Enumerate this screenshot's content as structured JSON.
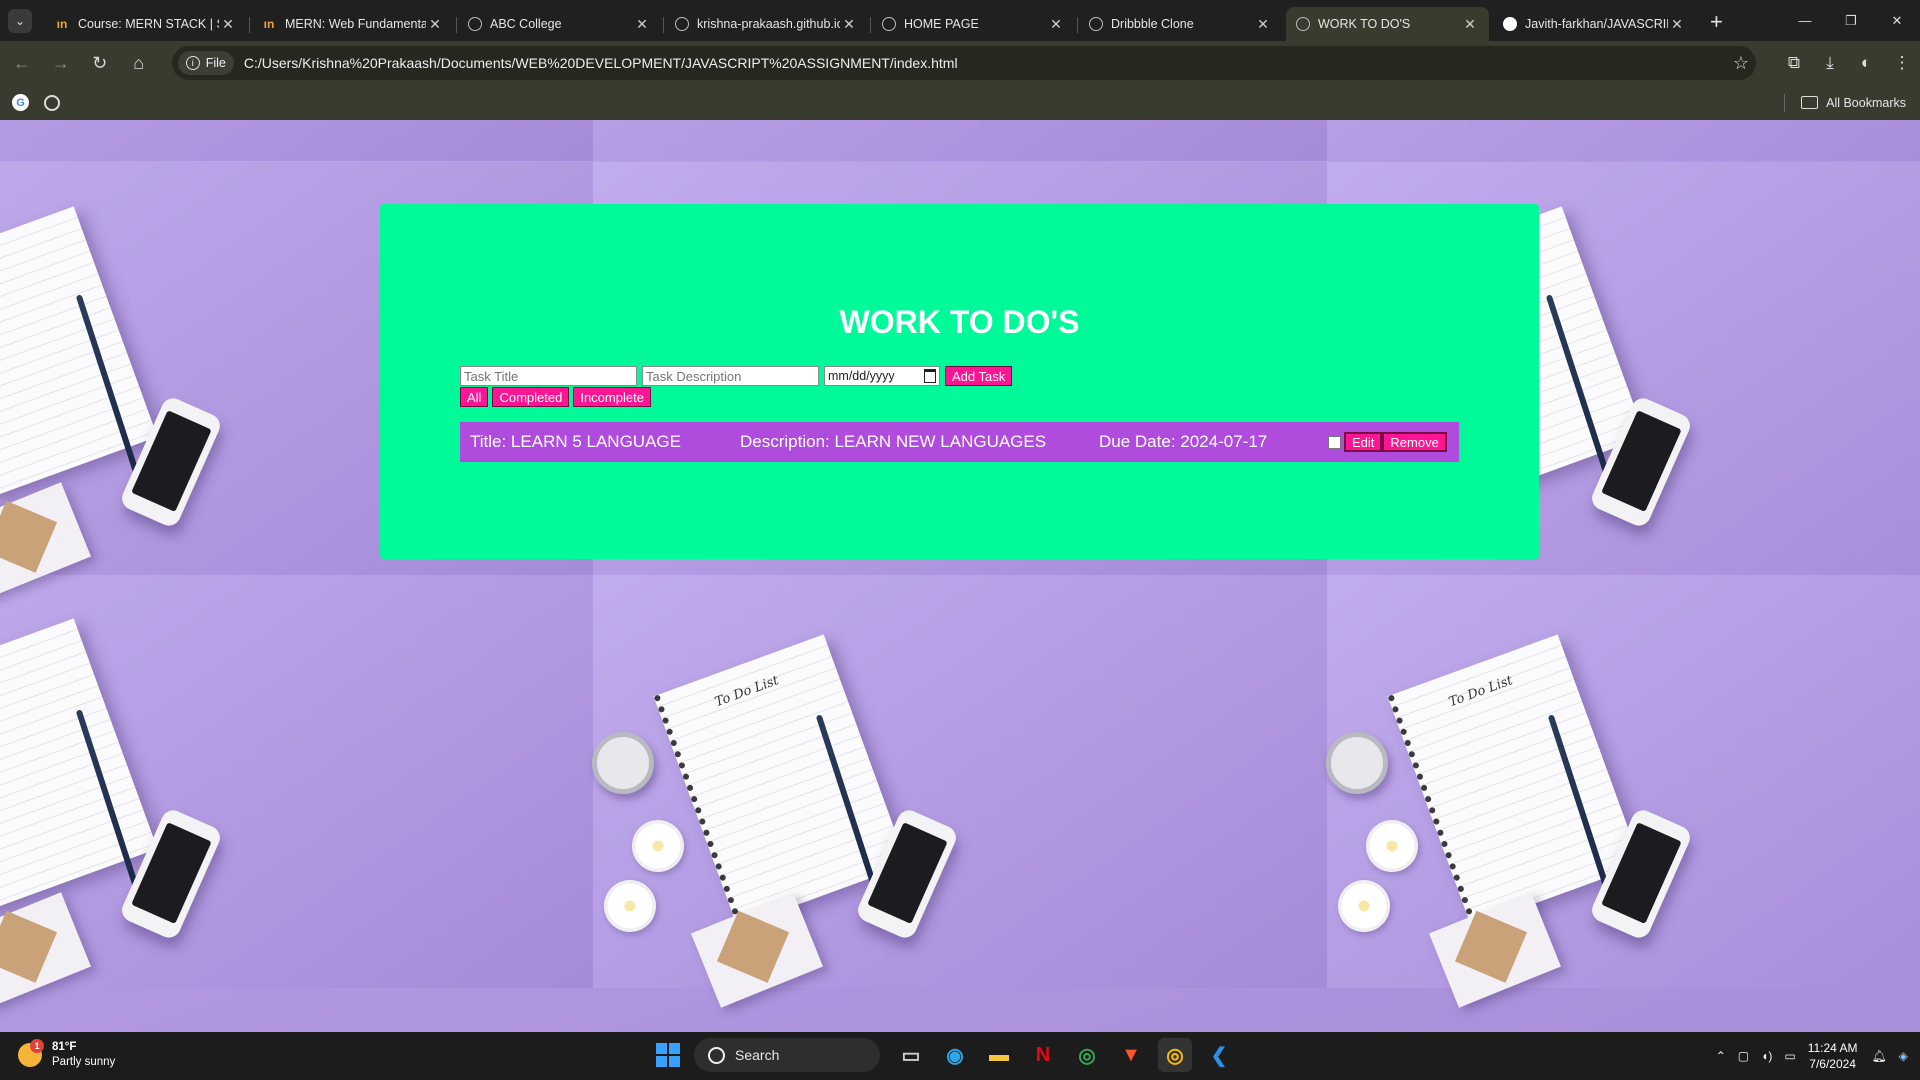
{
  "browser": {
    "tabs": [
      {
        "title": "Course: MERN STACK | SE",
        "favicon": "ftr-icon"
      },
      {
        "title": "MERN: Web Fundamental",
        "favicon": "ftr-icon"
      },
      {
        "title": "ABC College",
        "favicon": "globe-icon"
      },
      {
        "title": "krishna-prakaash.github.io",
        "favicon": "globe-icon"
      },
      {
        "title": "HOME PAGE",
        "favicon": "globe-icon"
      },
      {
        "title": "Dribbble Clone",
        "favicon": "globe-icon"
      },
      {
        "title": "WORK TO DO'S",
        "favicon": "globe-icon",
        "active": true
      },
      {
        "title": "Javith-farkhan/JAVASCRIP",
        "favicon": "github-icon"
      }
    ],
    "scheme_chip": "File",
    "url": "C:/Users/Krishna%20Prakaash/Documents/WEB%20DEVELOPMENT/JAVASCRIPT%20ASSIGNMENT/index.html",
    "bookmarks_label": "All Bookmarks"
  },
  "app": {
    "heading": "WORK TO DO'S",
    "title_placeholder": "Task Title",
    "description_placeholder": "Task Description",
    "date_placeholder": "mm/dd/yyyy",
    "add_task_label": "Add Task",
    "filters": {
      "all": "All",
      "completed": "Completed",
      "incomplete": "Incomplete"
    },
    "tasks": [
      {
        "title": "Title: LEARN 5 LANGUAGE",
        "description": "Description: LEARN NEW LANGUAGES",
        "due": "Due Date: 2024-07-17",
        "completed": false,
        "edit_label": "Edit",
        "remove_label": "Remove"
      }
    ],
    "colors": {
      "card": "#00fa9a",
      "button": "#ff1493",
      "task_row": "#b04cdd"
    }
  },
  "taskbar": {
    "weather_temp": "81°F",
    "weather_desc": "Partly sunny",
    "weather_badge": "1",
    "search_label": "Search",
    "time": "11:24 AM",
    "date": "7/6/2024"
  }
}
